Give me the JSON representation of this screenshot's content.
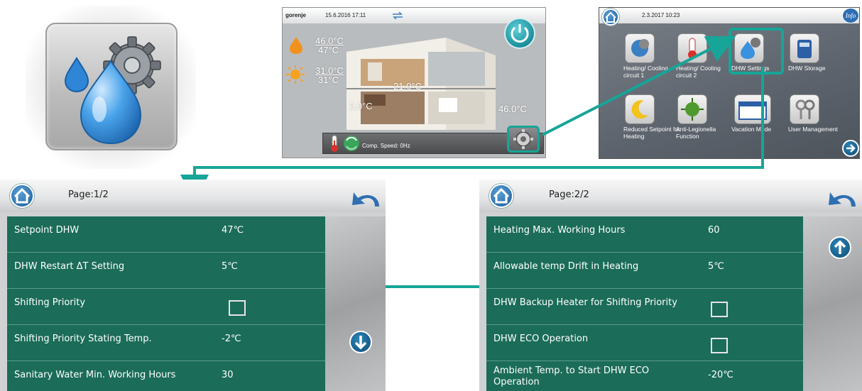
{
  "home_screen": {
    "brand": "gorenje",
    "datetime": "15.6.2016 17:11",
    "water_temp": "46.0°C",
    "water_setpoint": "47°C",
    "outdoor_temp": "31.0°C",
    "outdoor_setpoint": "31°C",
    "room_temp": "21.0°C",
    "left_temp": "2.0°C",
    "right_temp": "46.0°C",
    "comp_speed": "Comp. Speed: 0Hz"
  },
  "menu_screen": {
    "datetime": "2.3.2017 10:23",
    "info_label": "Info",
    "items": [
      {
        "label": "Heating/ Cooling circuit 1",
        "icon": "heating-cooling-icon"
      },
      {
        "label": "Heating/ Cooling circuit 2",
        "icon": "thermometer-icon"
      },
      {
        "label": "DHW Settings",
        "icon": "dhw-settings-icon"
      },
      {
        "label": "DHW Storage",
        "icon": "dhw-storage-icon"
      },
      {
        "label": "Reduced Setpoint for Heating",
        "icon": "moon-icon"
      },
      {
        "label": "Anti-Legionella Function",
        "icon": "bacteria-icon"
      },
      {
        "label": "Vacation Mode",
        "icon": "calendar-icon"
      },
      {
        "label": "User Management",
        "icon": "keys-icon"
      }
    ]
  },
  "page1": {
    "page_label": "Page:1/2",
    "rows": [
      {
        "label": "Setpoint DHW",
        "value": "47℃"
      },
      {
        "label": "DHW Restart ΔT Setting",
        "value": "5℃"
      },
      {
        "label": "Shifting Priority",
        "value": ""
      },
      {
        "label": "Shifting Priority Stating Temp.",
        "value": "-2℃"
      },
      {
        "label": "Sanitary Water Min. Working Hours",
        "value": "30"
      }
    ]
  },
  "page2": {
    "page_label": "Page:2/2",
    "rows": [
      {
        "label": "Heating Max. Working Hours",
        "value": "60"
      },
      {
        "label": "Allowable temp Drift in Heating",
        "value": "5℃"
      },
      {
        "label": "DHW Backup Heater for Shifting Priority",
        "value": ""
      },
      {
        "label": "DHW ECO Operation",
        "value": ""
      },
      {
        "label": "Ambient Temp. to Start DHW ECO Operation",
        "value": "-20℃"
      }
    ]
  },
  "colors": {
    "row_green": "#1b6c59",
    "highlight_teal": "#16a598",
    "arrow_teal": "#16a598"
  }
}
